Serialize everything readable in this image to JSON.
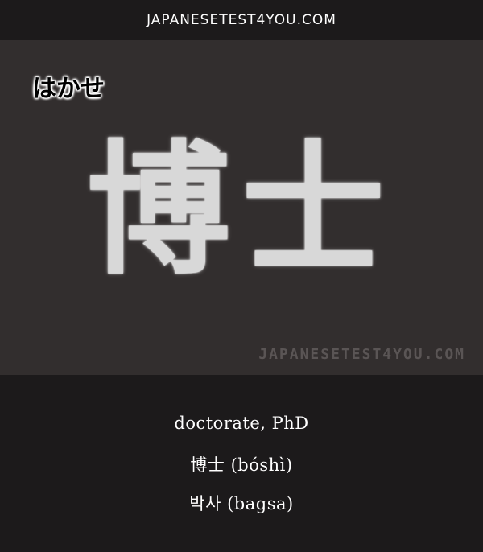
{
  "header": {
    "site": "JAPANESETEST4YOU.COM"
  },
  "card": {
    "reading": "はかせ",
    "kanji": "博士",
    "watermark": "JAPANESETEST4YOU.COM"
  },
  "footer": {
    "meaning": "doctorate, PhD",
    "chinese": "博士 (bóshì)",
    "korean": "박사 (bagsa)"
  }
}
